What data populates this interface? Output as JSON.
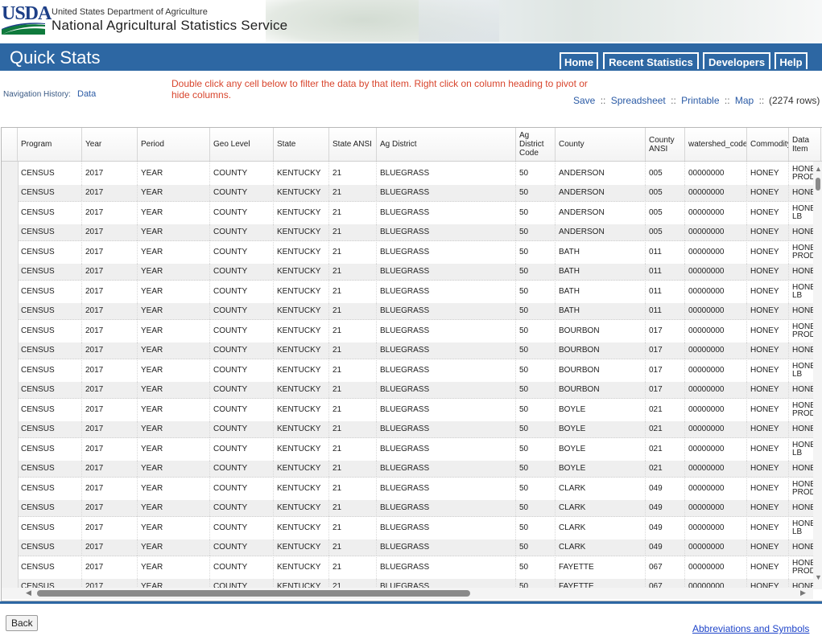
{
  "header": {
    "logo_text": "USDA",
    "department": "United States Department of Agriculture",
    "agency": "National Agricultural Statistics Service",
    "app_title": "Quick Stats",
    "nav": [
      "Home",
      "Recent Statistics",
      "Developers",
      "Help"
    ],
    "brand_color": "#2d67a3"
  },
  "nav_history": {
    "label": "Navigation History:",
    "link": "Data"
  },
  "hint": "Double click any cell below to filter the data by that item. Right click on column heading to pivot or hide columns.",
  "actions": {
    "save": "Save",
    "spreadsheet": "Spreadsheet",
    "printable": "Printable",
    "map": "Map",
    "separator": "::"
  },
  "row_count": "(2274 rows)",
  "table": {
    "columns": [
      "Program",
      "Year",
      "Period",
      "Geo Level",
      "State",
      "State ANSI",
      "Ag District",
      "Ag\nDistrict\nCode",
      "County",
      "County\nANSI",
      "watershed_code",
      "Commodity",
      "Data Item"
    ],
    "rows": [
      [
        "CENSUS",
        "2017",
        "YEAR",
        "COUNTY",
        "KENTUCKY",
        "21",
        "BLUEGRASS",
        "50",
        "ANDERSON",
        "005",
        "00000000",
        "HONEY",
        "HONEY\nPROD"
      ],
      [
        "CENSUS",
        "2017",
        "YEAR",
        "COUNTY",
        "KENTUCKY",
        "21",
        "BLUEGRASS",
        "50",
        "ANDERSON",
        "005",
        "00000000",
        "HONEY",
        "HONEY"
      ],
      [
        "CENSUS",
        "2017",
        "YEAR",
        "COUNTY",
        "KENTUCKY",
        "21",
        "BLUEGRASS",
        "50",
        "ANDERSON",
        "005",
        "00000000",
        "HONEY",
        "HONEY\nLB"
      ],
      [
        "CENSUS",
        "2017",
        "YEAR",
        "COUNTY",
        "KENTUCKY",
        "21",
        "BLUEGRASS",
        "50",
        "ANDERSON",
        "005",
        "00000000",
        "HONEY",
        "HONEY"
      ],
      [
        "CENSUS",
        "2017",
        "YEAR",
        "COUNTY",
        "KENTUCKY",
        "21",
        "BLUEGRASS",
        "50",
        "BATH",
        "011",
        "00000000",
        "HONEY",
        "HONEY\nPROD"
      ],
      [
        "CENSUS",
        "2017",
        "YEAR",
        "COUNTY",
        "KENTUCKY",
        "21",
        "BLUEGRASS",
        "50",
        "BATH",
        "011",
        "00000000",
        "HONEY",
        "HONEY"
      ],
      [
        "CENSUS",
        "2017",
        "YEAR",
        "COUNTY",
        "KENTUCKY",
        "21",
        "BLUEGRASS",
        "50",
        "BATH",
        "011",
        "00000000",
        "HONEY",
        "HONEY\nLB"
      ],
      [
        "CENSUS",
        "2017",
        "YEAR",
        "COUNTY",
        "KENTUCKY",
        "21",
        "BLUEGRASS",
        "50",
        "BATH",
        "011",
        "00000000",
        "HONEY",
        "HONEY"
      ],
      [
        "CENSUS",
        "2017",
        "YEAR",
        "COUNTY",
        "KENTUCKY",
        "21",
        "BLUEGRASS",
        "50",
        "BOURBON",
        "017",
        "00000000",
        "HONEY",
        "HONEY\nPROD"
      ],
      [
        "CENSUS",
        "2017",
        "YEAR",
        "COUNTY",
        "KENTUCKY",
        "21",
        "BLUEGRASS",
        "50",
        "BOURBON",
        "017",
        "00000000",
        "HONEY",
        "HONEY"
      ],
      [
        "CENSUS",
        "2017",
        "YEAR",
        "COUNTY",
        "KENTUCKY",
        "21",
        "BLUEGRASS",
        "50",
        "BOURBON",
        "017",
        "00000000",
        "HONEY",
        "HONEY\nLB"
      ],
      [
        "CENSUS",
        "2017",
        "YEAR",
        "COUNTY",
        "KENTUCKY",
        "21",
        "BLUEGRASS",
        "50",
        "BOURBON",
        "017",
        "00000000",
        "HONEY",
        "HONEY"
      ],
      [
        "CENSUS",
        "2017",
        "YEAR",
        "COUNTY",
        "KENTUCKY",
        "21",
        "BLUEGRASS",
        "50",
        "BOYLE",
        "021",
        "00000000",
        "HONEY",
        "HONEY\nPROD"
      ],
      [
        "CENSUS",
        "2017",
        "YEAR",
        "COUNTY",
        "KENTUCKY",
        "21",
        "BLUEGRASS",
        "50",
        "BOYLE",
        "021",
        "00000000",
        "HONEY",
        "HONEY"
      ],
      [
        "CENSUS",
        "2017",
        "YEAR",
        "COUNTY",
        "KENTUCKY",
        "21",
        "BLUEGRASS",
        "50",
        "BOYLE",
        "021",
        "00000000",
        "HONEY",
        "HONEY\nLB"
      ],
      [
        "CENSUS",
        "2017",
        "YEAR",
        "COUNTY",
        "KENTUCKY",
        "21",
        "BLUEGRASS",
        "50",
        "BOYLE",
        "021",
        "00000000",
        "HONEY",
        "HONEY"
      ],
      [
        "CENSUS",
        "2017",
        "YEAR",
        "COUNTY",
        "KENTUCKY",
        "21",
        "BLUEGRASS",
        "50",
        "CLARK",
        "049",
        "00000000",
        "HONEY",
        "HONEY\nPROD"
      ],
      [
        "CENSUS",
        "2017",
        "YEAR",
        "COUNTY",
        "KENTUCKY",
        "21",
        "BLUEGRASS",
        "50",
        "CLARK",
        "049",
        "00000000",
        "HONEY",
        "HONEY"
      ],
      [
        "CENSUS",
        "2017",
        "YEAR",
        "COUNTY",
        "KENTUCKY",
        "21",
        "BLUEGRASS",
        "50",
        "CLARK",
        "049",
        "00000000",
        "HONEY",
        "HONEY\nLB"
      ],
      [
        "CENSUS",
        "2017",
        "YEAR",
        "COUNTY",
        "KENTUCKY",
        "21",
        "BLUEGRASS",
        "50",
        "CLARK",
        "049",
        "00000000",
        "HONEY",
        "HONEY"
      ],
      [
        "CENSUS",
        "2017",
        "YEAR",
        "COUNTY",
        "KENTUCKY",
        "21",
        "BLUEGRASS",
        "50",
        "FAYETTE",
        "067",
        "00000000",
        "HONEY",
        "HONEY\nPROD"
      ],
      [
        "CENSUS",
        "2017",
        "YEAR",
        "COUNTY",
        "KENTUCKY",
        "21",
        "BLUEGRASS",
        "50",
        "FAYETTE",
        "067",
        "00000000",
        "HONEY",
        "HONEY"
      ]
    ]
  },
  "footer": {
    "back": "Back",
    "abbreviations": "Abbreviations and Symbols"
  }
}
